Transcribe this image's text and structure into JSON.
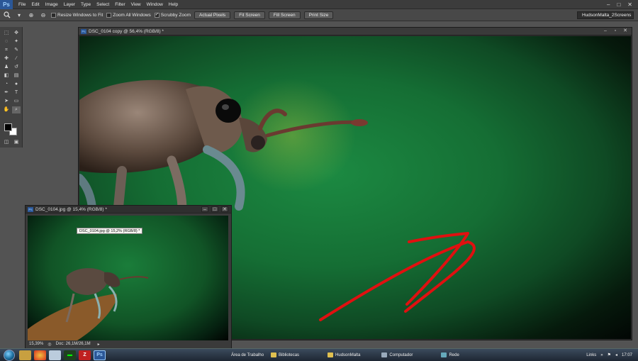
{
  "app": {
    "logo": "Ps"
  },
  "menu": [
    "File",
    "Edit",
    "Image",
    "Layer",
    "Type",
    "Select",
    "Filter",
    "View",
    "Window",
    "Help"
  ],
  "window_controls": [
    "–",
    "□",
    "✕"
  ],
  "options_bar": {
    "tool_icon": "zoom-icon",
    "resize_windows": {
      "label": "Resize Windows to Fit",
      "checked": false
    },
    "zoom_all": {
      "label": "Zoom All Windows",
      "checked": false
    },
    "scrubby": {
      "label": "Scrubby Zoom",
      "checked": true
    },
    "buttons": [
      "Actual Pixels",
      "Fit Screen",
      "Fill Screen",
      "Print Size"
    ],
    "workspace": "HudsonMalta_2Screens"
  },
  "main_doc": {
    "title": "DSC_0104 copy @ 56,4% (RGB/8) *",
    "badge": "Ps"
  },
  "small_doc": {
    "title": "DSC_0104.jpg @ 15,4% (RGB/8) *",
    "badge": "Ps",
    "tooltip": "DSC_0104.jpg @ 15,2% (RGB/8) *",
    "zoom": "15,39%",
    "doc_info": "Doc: 26,1M/26,1M"
  },
  "taskbar": {
    "windows": [
      "Área de Trabalho",
      "Bibliotecas",
      "HudsonMalta",
      "Computador",
      "Rede"
    ],
    "links": "Links",
    "time": "17:07"
  },
  "colors": {
    "accent": "#2b5797",
    "arrow": "#e01010",
    "canvas_green": "#156e34"
  }
}
